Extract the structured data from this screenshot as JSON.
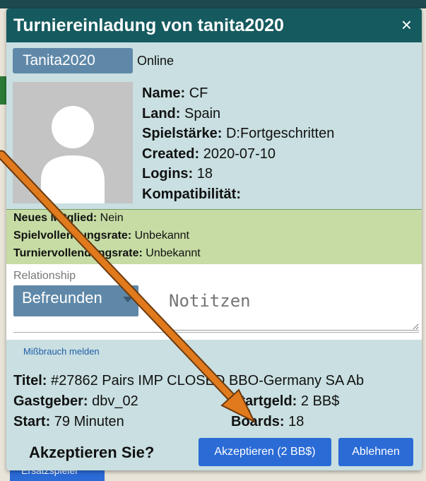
{
  "dialog": {
    "title": "Turniereinladung von tanita2020",
    "close_symbol": "×"
  },
  "user": {
    "username": "Tanita2020",
    "status": "Online",
    "fields": [
      {
        "label": "Name:",
        "value": " CF"
      },
      {
        "label": "Land:",
        "value": " Spain"
      },
      {
        "label": "Spielstärke:",
        "value": " D:Fortgeschritten"
      },
      {
        "label": "Created:",
        "value": " 2020-07-10"
      },
      {
        "label": "Logins:",
        "value": " 18"
      },
      {
        "label": "Kompatibilität:",
        "value": ""
      }
    ]
  },
  "member_info": [
    {
      "label": "Neues Mitglied:",
      "value": " Nein"
    },
    {
      "label": "Spielvollendungsrate:",
      "value": " Unbekannt"
    },
    {
      "label": "Turniervollendungsrate:",
      "value": " Unbekannt"
    }
  ],
  "relationship": {
    "label": "Relationship",
    "selected": "Befreunden",
    "notes_placeholder": "Notitzen"
  },
  "report_link": "Mißbrauch melden",
  "tournament": {
    "title_label": "Titel:",
    "title_value": " #27862 Pairs IMP CLOSED BBO-Germany SA Ab",
    "host_label": "Gastgeber:",
    "host_value": " dbv_02",
    "fee_label": "Startgeld:",
    "fee_value": " 2 BB$",
    "start_label": "Start:",
    "start_value": " 79 Minuten",
    "boards_label": "Boards:",
    "boards_value": " 18"
  },
  "footer": {
    "question": "Akzeptieren Sie?",
    "accept_label": "Akzeptieren (2 BB$)",
    "decline_label": "Ablehnen"
  },
  "background": {
    "partial_button": "Ersatzspieler"
  },
  "colors": {
    "title_bar": "#155a5f",
    "dialog_bg": "#c9dfe1",
    "green_panel": "#c6dca4",
    "user_button": "#5f88a8",
    "primary_button": "#2b6bd6",
    "arrow": "#e07a1c"
  }
}
